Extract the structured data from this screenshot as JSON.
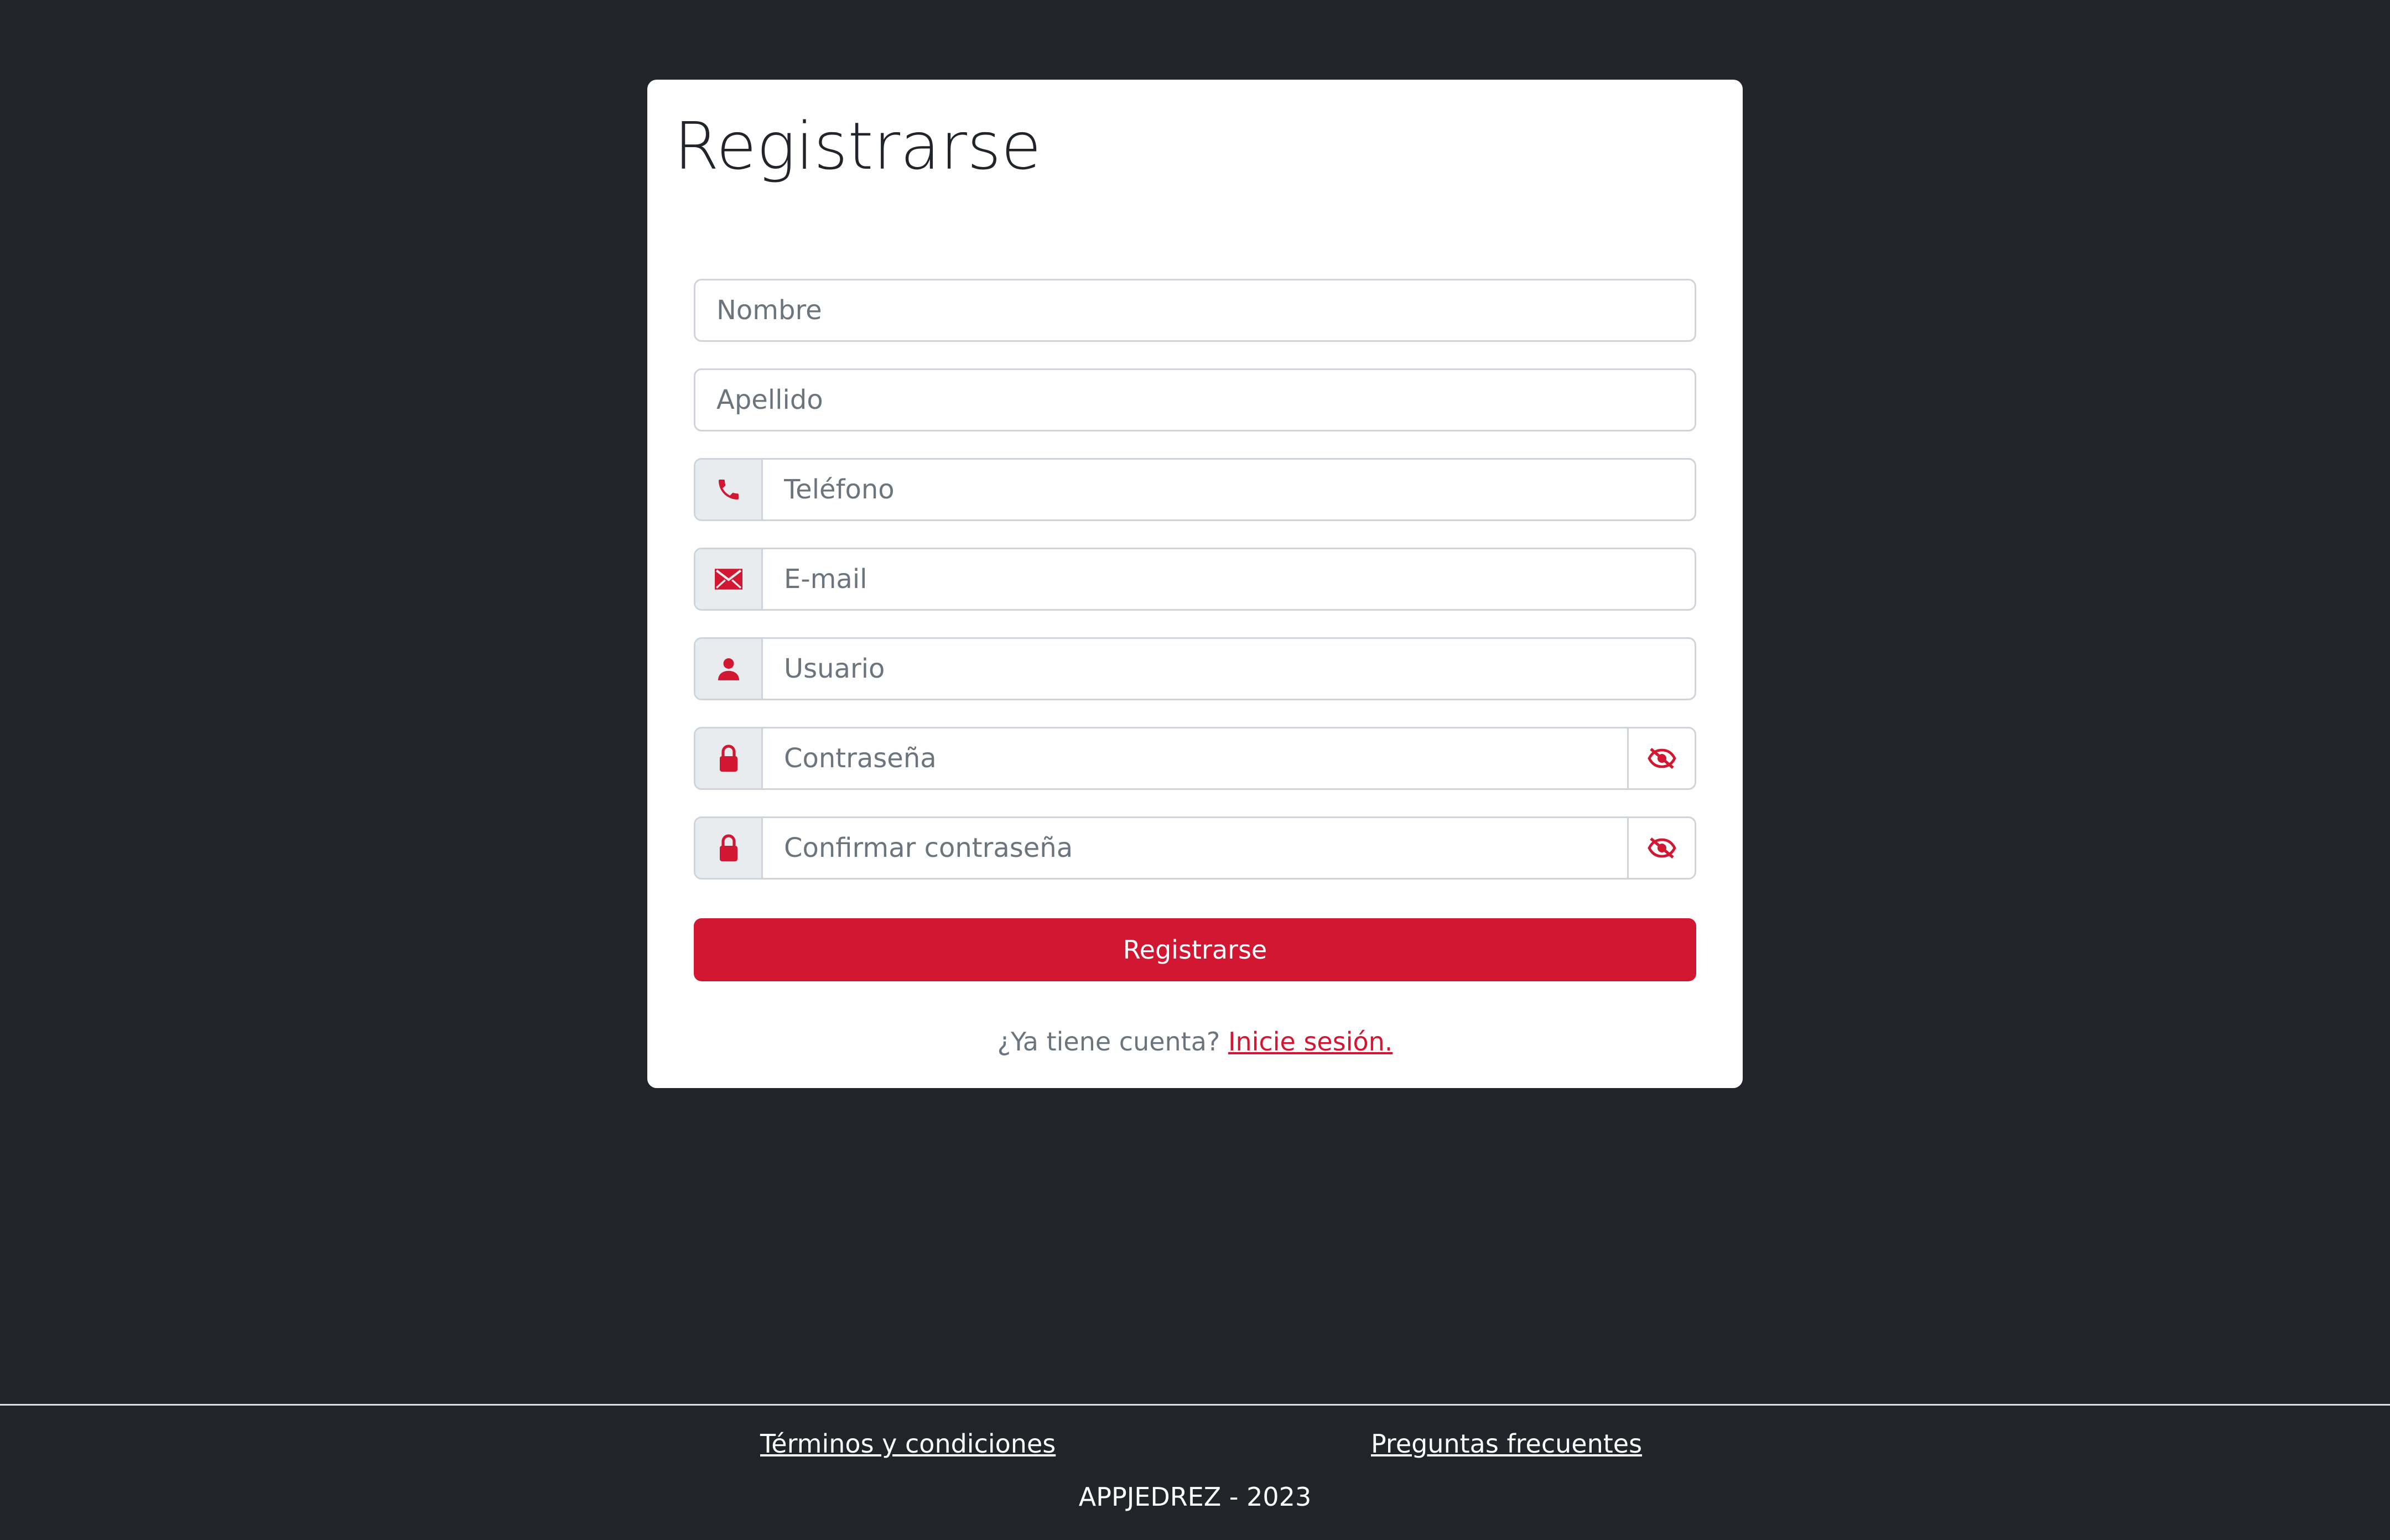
{
  "theme": {
    "background": "#212529",
    "card_background": "#ffffff",
    "accent": "#d21733",
    "addon_background": "#e9ecef",
    "border": "#ced4da",
    "placeholder": "#6c757d"
  },
  "form": {
    "title": "Registrarse",
    "fields": {
      "nombre": {
        "placeholder": "Nombre",
        "value": ""
      },
      "apellido": {
        "placeholder": "Apellido",
        "value": ""
      },
      "telefono": {
        "placeholder": "Teléfono",
        "value": "",
        "icon": "phone-icon"
      },
      "email": {
        "placeholder": "E-mail",
        "value": "",
        "icon": "envelope-icon"
      },
      "usuario": {
        "placeholder": "Usuario",
        "value": "",
        "icon": "user-icon"
      },
      "password": {
        "placeholder": "Contraseña",
        "value": "",
        "icon": "lock-icon",
        "toggle_icon": "eye-slash-icon"
      },
      "confirm_password": {
        "placeholder": "Confirmar contraseña",
        "value": "",
        "icon": "lock-icon",
        "toggle_icon": "eye-slash-icon"
      }
    },
    "submit_label": "Registrarse",
    "login_prompt": "¿Ya tiene cuenta?",
    "login_link": "Inicie sesión."
  },
  "footer": {
    "terms_link": "Términos y condiciones",
    "faq_link": "Preguntas frecuentes",
    "copyright": "APPJEDREZ - 2023"
  }
}
